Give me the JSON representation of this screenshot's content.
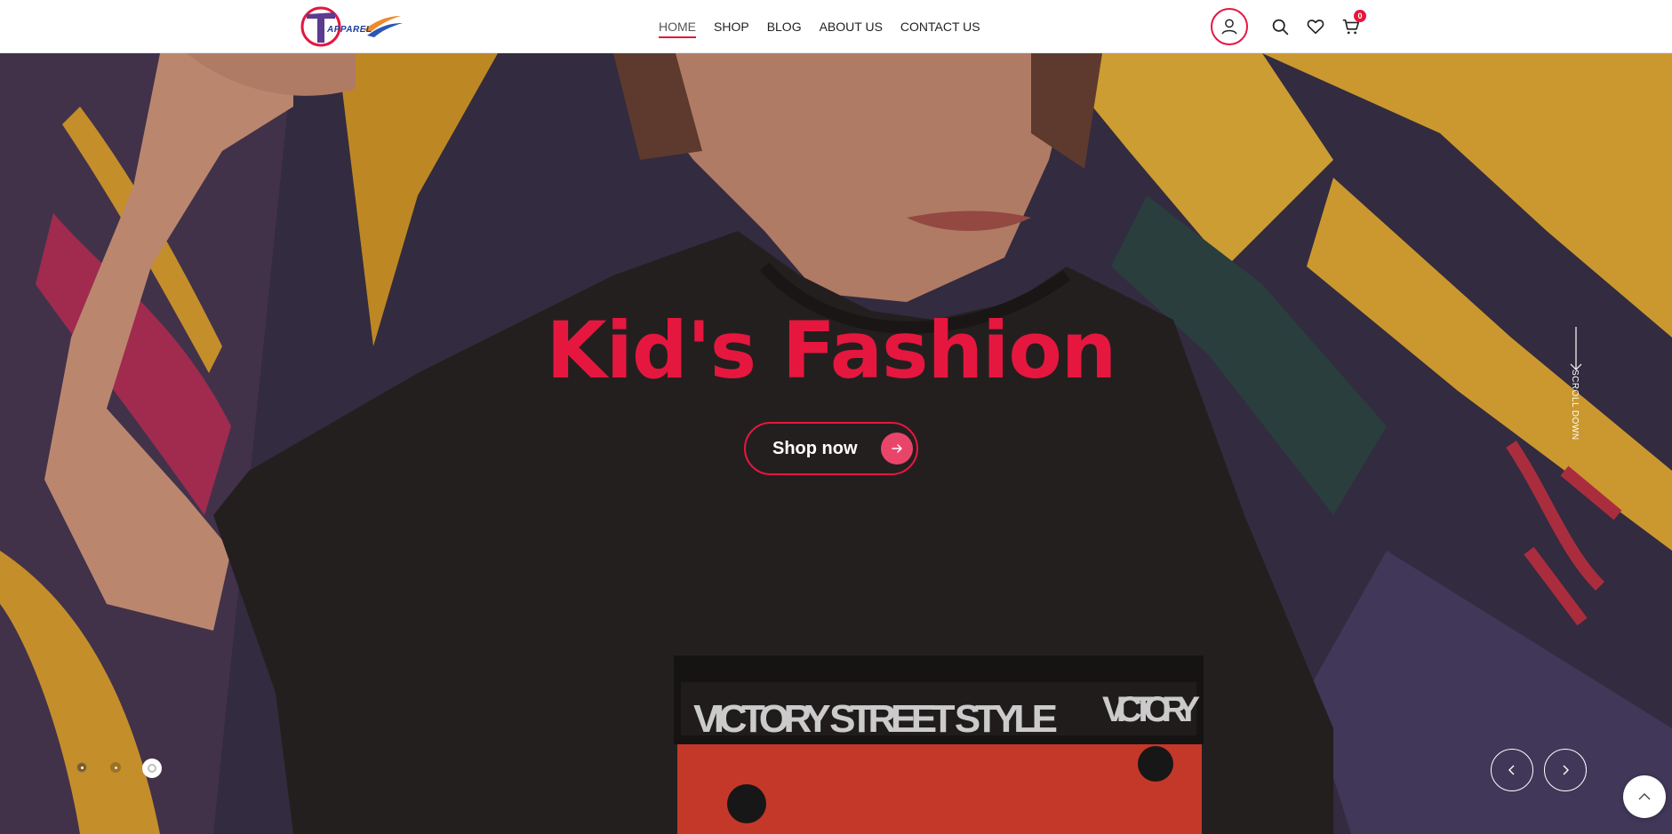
{
  "brand": {
    "logo_letter": "T",
    "logo_text": "APPAREL"
  },
  "nav": {
    "items": [
      {
        "label": "HOME",
        "active": true
      },
      {
        "label": "SHOP",
        "active": false
      },
      {
        "label": "BLOG",
        "active": false
      },
      {
        "label": "ABOUT US",
        "active": false
      },
      {
        "label": "CONTACT US",
        "active": false
      }
    ]
  },
  "header_icons": {
    "account": "user-icon",
    "search": "search-icon",
    "wishlist": "heart-icon",
    "cart": "cart-icon",
    "cart_count": "0"
  },
  "hero": {
    "title": "Kid's Fashion",
    "cta_label": "Shop now",
    "scroll_label": "SCROLL DOWN",
    "active_slide": 3,
    "slide_count": 3
  },
  "colors": {
    "accent": "#e5173f",
    "button_arrow": "#e9456b",
    "header_bg": "#ffffff"
  }
}
